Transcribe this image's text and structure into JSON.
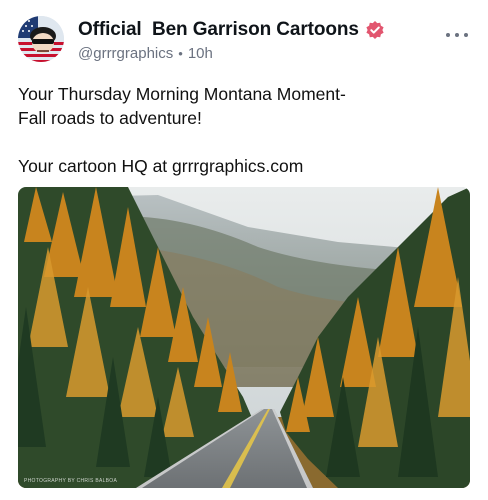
{
  "post": {
    "author": {
      "display_name": "Official  Ben Garrison Cartoons",
      "handle": "@grrrgraphics",
      "time": "10h",
      "verified_icon": "verified-badge-icon"
    },
    "more_icon": "more-horizontal-icon",
    "body": {
      "line1": "Your Thursday Morning Montana Moment-",
      "line2": "Fall roads to adventure!",
      "line3": "Your cartoon HQ at grrrgraphics.com"
    },
    "media": {
      "credit": "PHOTOGRAPHY BY CHRIS BALBOA"
    }
  },
  "colors": {
    "verified": "#e2566f",
    "meta": "#6b7280"
  }
}
